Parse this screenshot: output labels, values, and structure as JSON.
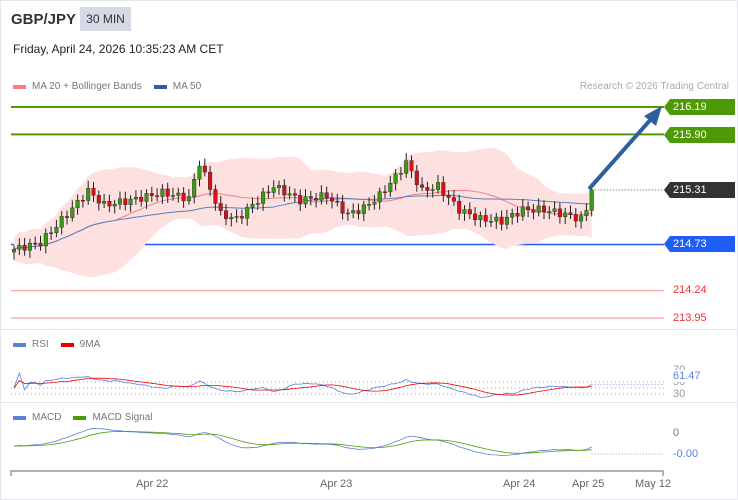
{
  "header": {
    "symbol": "GBP/JPY",
    "timeframe": "30 MIN",
    "datetime": "Friday, April 24, 2026 10:35:23 AM CET"
  },
  "legend": {
    "ma20": "MA 20 + Bollinger Bands",
    "ma50": "MA 50",
    "credit": "Research © 2026 Trading Central"
  },
  "levels": {
    "r2": "216.19",
    "r1": "215.90",
    "last": "215.31",
    "pivot": "214.73",
    "s1": "214.24",
    "s2": "213.95"
  },
  "rsi": {
    "label": "RSI",
    "ma_label": "9MA",
    "value": "61.47",
    "lvl70": "70",
    "lvl50": "50",
    "lvl30": "30"
  },
  "macd": {
    "label": "MACD",
    "signal_label": "MACD Signal",
    "zero": "0",
    "value": "-0.00"
  },
  "xaxis": [
    "Apr 22",
    "Apr 23",
    "Apr 24",
    "Apr 25",
    "May 12"
  ],
  "colors": {
    "up": "#3a9a12",
    "down": "#d8101a",
    "green": "#4e9a06",
    "blue": "#1e5ef5",
    "dark": "#333333",
    "support": "#f03030",
    "arrow": "#2f5fa0"
  },
  "price_path": [
    [
      0,
      214.68
    ],
    [
      5,
      214.75
    ],
    [
      10,
      215.05
    ],
    [
      14,
      215.3
    ],
    [
      17,
      215.15
    ],
    [
      22,
      215.2
    ],
    [
      28,
      215.28
    ],
    [
      33,
      215.22
    ],
    [
      35,
      215.6
    ],
    [
      39,
      215.05
    ],
    [
      42,
      215.0
    ],
    [
      46,
      215.2
    ],
    [
      49,
      215.35
    ],
    [
      54,
      215.2
    ],
    [
      59,
      215.25
    ],
    [
      63,
      215.05
    ],
    [
      66,
      215.12
    ],
    [
      69,
      215.25
    ],
    [
      72,
      215.45
    ],
    [
      74,
      215.6
    ],
    [
      77,
      215.3
    ],
    [
      80,
      215.35
    ],
    [
      84,
      215.1
    ],
    [
      88,
      215.0
    ],
    [
      92,
      214.98
    ],
    [
      96,
      215.1
    ],
    [
      100,
      215.1
    ],
    [
      104,
      215.05
    ],
    [
      107,
      215.0
    ],
    [
      108,
      215.1
    ],
    [
      109,
      215.31
    ]
  ]
}
